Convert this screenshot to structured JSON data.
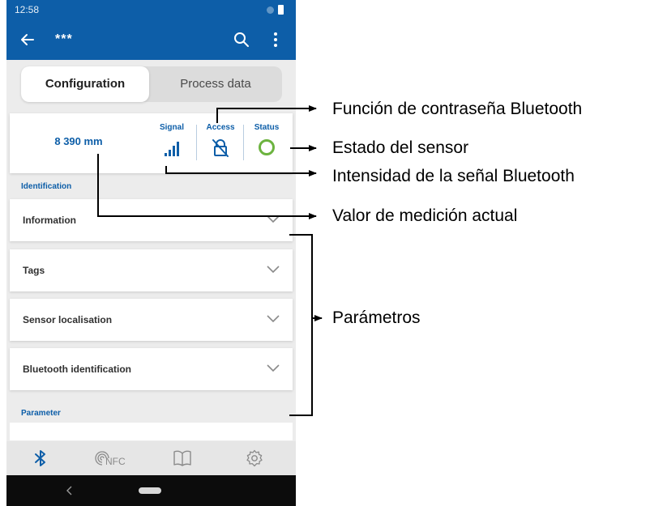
{
  "status_bar": {
    "time": "12:58"
  },
  "app_bar": {
    "title": "***",
    "icons": [
      "back-arrow-icon",
      "search-icon",
      "more-vert-icon"
    ]
  },
  "tabs": [
    {
      "label": "Configuration",
      "active": true
    },
    {
      "label": "Process data",
      "active": false
    }
  ],
  "summary": {
    "measurement": "8 390 mm",
    "signal": {
      "label": "Signal",
      "icon": "signal-bars-icon"
    },
    "access": {
      "label": "Access",
      "icon": "lock-crossed-icon"
    },
    "status": {
      "label": "Status",
      "icon": "status-ring-icon",
      "color": "#6cb33f"
    }
  },
  "sections": {
    "identification": "Identification",
    "items": [
      {
        "label": "Information"
      },
      {
        "label": "Tags"
      },
      {
        "label": "Sensor localisation"
      },
      {
        "label": "Bluetooth identification"
      }
    ],
    "parameter": "Parameter"
  },
  "bottom_nav": {
    "items": [
      "bluetooth-icon",
      "nfc-icon",
      "book-icon",
      "settings-gear-icon"
    ],
    "nfc_label": "NFC"
  },
  "annotations": [
    {
      "text": "Función de contraseña Bluetooth"
    },
    {
      "text": "Estado del sensor"
    },
    {
      "text": "Intensidad de la señal Bluetooth"
    },
    {
      "text": "Valor de medición actual"
    },
    {
      "text": "Parámetros"
    }
  ],
  "colors": {
    "primary": "#0d5ea8",
    "status_ok": "#6cb33f",
    "background": "#ececec"
  }
}
